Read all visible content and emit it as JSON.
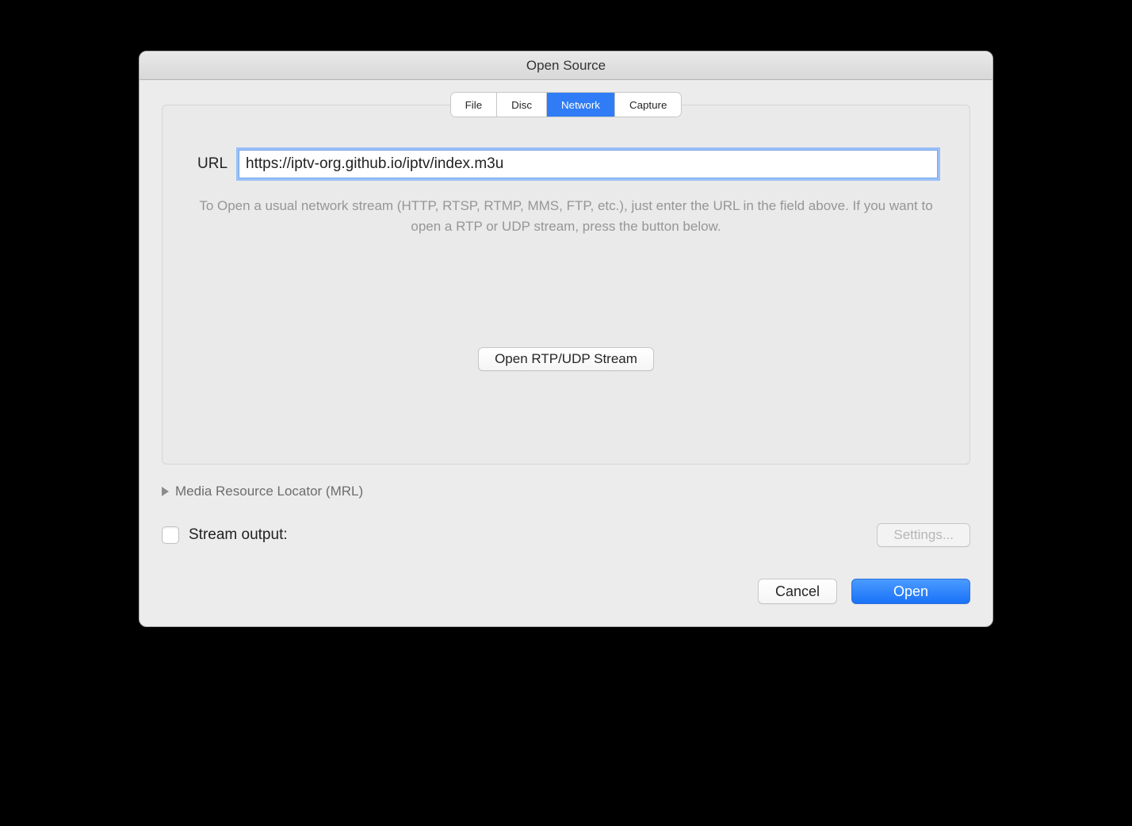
{
  "window": {
    "title": "Open Source"
  },
  "tabs": {
    "file": "File",
    "disc": "Disc",
    "network": "Network",
    "capture": "Capture"
  },
  "network": {
    "url_label": "URL",
    "url_value": "https://iptv-org.github.io/iptv/index.m3u",
    "hint": "To Open a usual network stream (HTTP, RTSP, RTMP, MMS, FTP, etc.), just enter the URL in the field above. If you want to open a RTP or UDP stream, press the button below.",
    "open_rtp_label": "Open RTP/UDP Stream"
  },
  "mrl": {
    "label": "Media Resource Locator (MRL)"
  },
  "stream": {
    "label": "Stream output:",
    "settings_label": "Settings..."
  },
  "buttons": {
    "cancel": "Cancel",
    "open": "Open"
  }
}
